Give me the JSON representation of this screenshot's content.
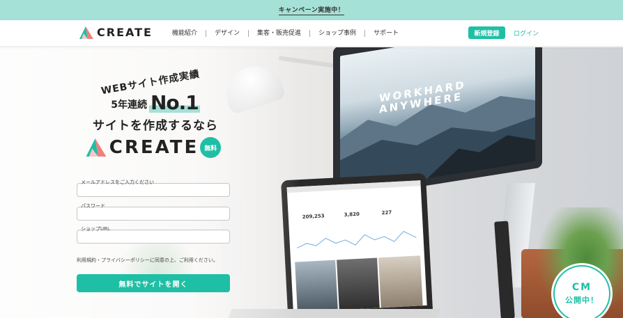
{
  "campaign_banner": "キャンペーン実施中！",
  "header": {
    "logo_text": "CREATE",
    "nav": [
      "機能紹介",
      "デザイン",
      "集客・販売促進",
      "ショップ事例",
      "サポート"
    ],
    "register_label": "新規登録",
    "login_label": "ログイン"
  },
  "hero": {
    "line1": "WEBサイト作成実績",
    "line2_small": "5年連続",
    "line2_big": "No.1",
    "line3": "サイトを作成するなら",
    "brand": "CREATE",
    "free_badge": "無料",
    "monitor_title": "WORKHARD ANYWHERE",
    "laptop_stats": [
      "209,253",
      "3,820",
      "227"
    ]
  },
  "form": {
    "email_label": "メールアドレスをご入力ください",
    "password_label": "パスワード",
    "shop_url_label": "ショップURL",
    "terms_text": "利用規約・プライバシーポリシーに同意の上、ご利用ください。",
    "submit_label": "無料でサイトを開く"
  },
  "cm_badge": {
    "line1": "CM",
    "line2": "公開中！"
  },
  "colors": {
    "accent": "#1fbfa5",
    "banner_bg": "#a5e1d6"
  }
}
